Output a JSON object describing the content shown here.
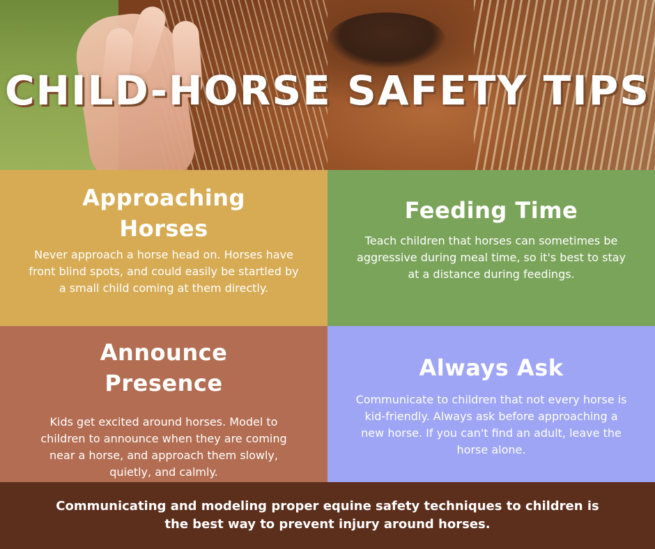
{
  "header": {
    "title": "CHILD-HORSE SAFETY TIPS"
  },
  "tips": [
    {
      "heading_line1": "Approaching",
      "heading_line2": "Horses",
      "body": "Never approach a horse head on. Horses have front blind spots, and could easily be startled by a small child coming at them directly.",
      "color": "#d6ab54"
    },
    {
      "heading_line1": "Feeding Time",
      "body": "Teach children that horses can sometimes be aggressive during meal time, so it's best to stay at a distance during feedings.",
      "color": "#7ba45b"
    },
    {
      "heading_line1": "Announce",
      "heading_line2": "Presence",
      "body": "Kids get excited around horses. Model to children to announce when they are coming near a horse, and approach them slowly, quietly, and calmly.",
      "color": "#b36d52"
    },
    {
      "heading_line1": "Always Ask",
      "body": "Communicate to children that not every horse is kid-friendly. Always ask before approaching a new horse. If you can't find an adult, leave the horse alone.",
      "color": "#9ea5f5"
    }
  ],
  "footer": {
    "text": "Communicating and modeling proper equine safety techniques to children is the best way to prevent injury around horses.",
    "color": "#5c2e1c"
  }
}
